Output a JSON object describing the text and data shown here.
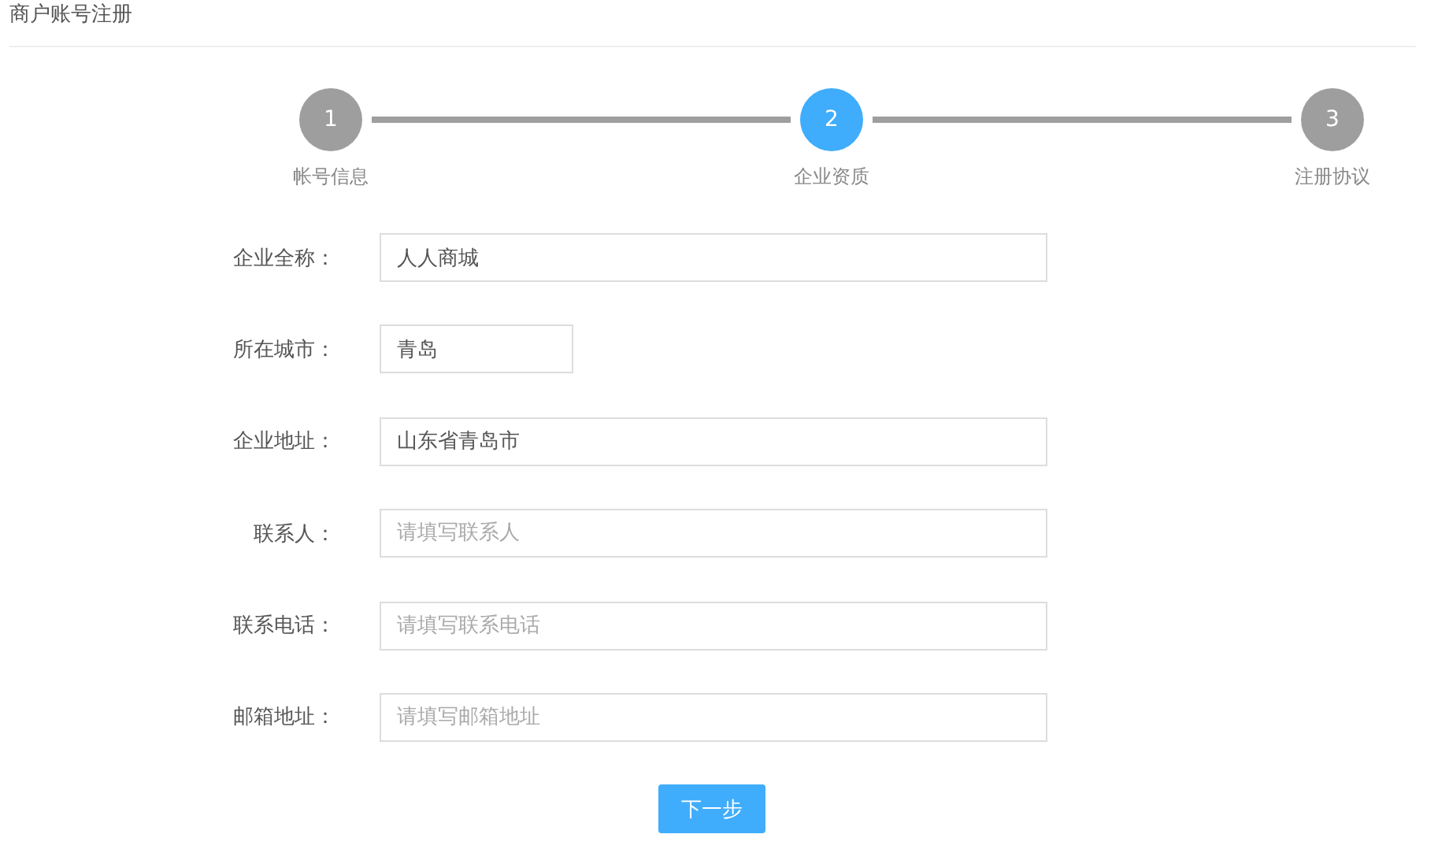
{
  "page_title": "商户账号注册",
  "steps": [
    {
      "number": "1",
      "label": "帐号信息",
      "selected": false
    },
    {
      "number": "2",
      "label": "企业资质",
      "selected": true
    },
    {
      "number": "3",
      "label": "注册协议",
      "selected": false
    }
  ],
  "fields": [
    {
      "label": "企业全称：",
      "value": "人人商城",
      "kind": "full"
    },
    {
      "label": "所在城市：",
      "value": "青岛",
      "kind": "short"
    },
    {
      "label": "企业地址：",
      "value": "山东省青岛市",
      "kind": "full"
    },
    {
      "label": "联系人：",
      "placeholder": "请填写联系人",
      "kind": "full"
    },
    {
      "label": "联系电话：",
      "placeholder": "请填写联系电话",
      "kind": "full"
    },
    {
      "label": "邮箱地址：",
      "placeholder": "请填写邮箱地址",
      "kind": "full"
    }
  ],
  "next_button": "下一步"
}
